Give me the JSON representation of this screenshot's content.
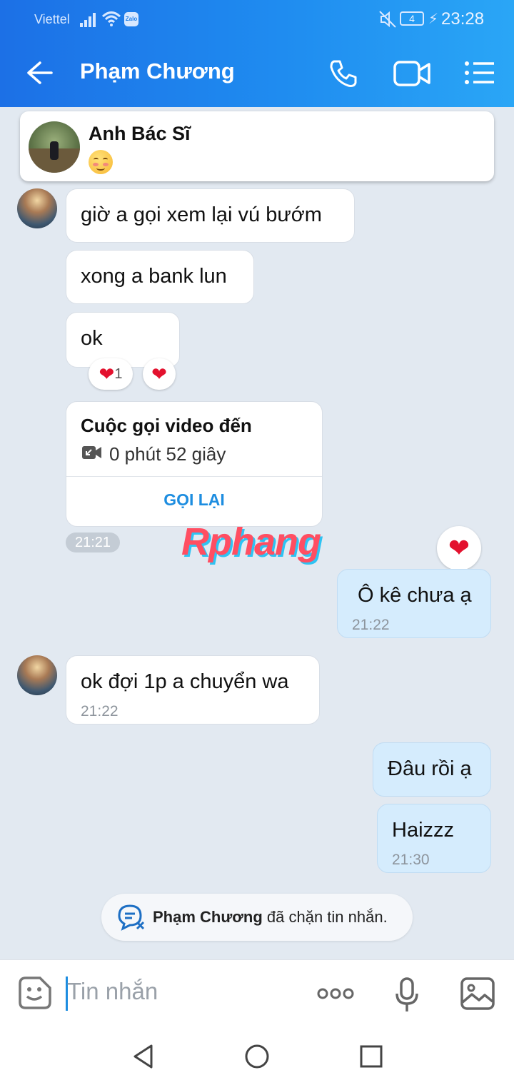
{
  "status_bar": {
    "carrier": "Viettel",
    "battery": "4",
    "time": "23:28",
    "icons": [
      "signal-icon",
      "wifi-icon",
      "zalo-icon",
      "mute-icon",
      "battery-icon"
    ]
  },
  "header": {
    "contact_name": "Phạm Chương",
    "icons": [
      "back-arrow-icon",
      "phone-icon",
      "video-call-icon",
      "menu-list-icon"
    ]
  },
  "pinned": {
    "name": "Anh Bác Sĩ",
    "emoji": "blushing-face-emoji"
  },
  "messages": {
    "m1": "giờ a gọi xem lại vú bướm",
    "m2": "xong a bank lun",
    "m3": "ok",
    "m3_reaction_count": "1",
    "call": {
      "title": "Cuộc gọi video đến",
      "duration": "0 phút 52 giây",
      "action": "GỌI LẠI"
    },
    "time_chip": "21:21",
    "m4": "Ô kê chưa ạ",
    "m4_time": "21:22",
    "m5": "ok đợi 1p a chuyển wa",
    "m5_time": "21:22",
    "m6": "Đâu rồi ạ",
    "m7": "Haizzz",
    "m7_time": "21:30"
  },
  "watermark": "Rphang",
  "system_notice": {
    "name": "Phạm Chương",
    "text": " đã chặn tin nhắn."
  },
  "composer": {
    "placeholder": "Tin nhắn",
    "icons": [
      "emoji-sticker-icon",
      "more-dots-icon",
      "microphone-icon",
      "image-icon"
    ]
  },
  "nav_bar": {
    "icons": [
      "nav-back-icon",
      "nav-home-icon",
      "nav-recents-icon"
    ]
  },
  "colors": {
    "header_gradient_start": "#1c70e6",
    "header_gradient_end": "#2aa6f6",
    "chat_background": "#e2e9f1",
    "my_bubble": "#d5ecfd",
    "accent": "#1d8de0",
    "heart": "#e3112e"
  }
}
